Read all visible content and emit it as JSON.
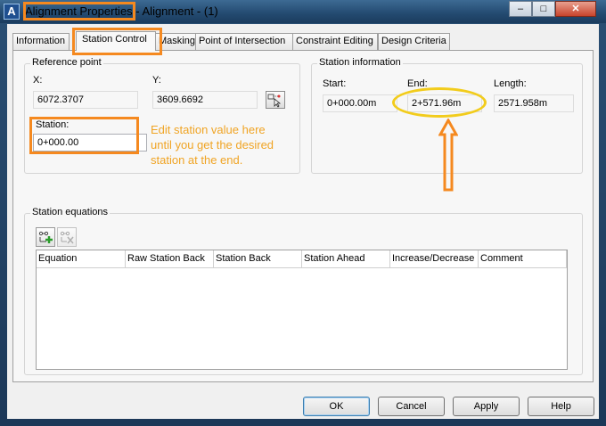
{
  "window": {
    "title": "Alignment Properties - Alignment - (1)",
    "icon": "autocad-icon",
    "controls": {
      "minimize": "–",
      "maximize": "□",
      "close": "✕"
    }
  },
  "tabs": [
    {
      "label": "Information",
      "active": false
    },
    {
      "label": "Station Control",
      "active": true
    },
    {
      "label": "Masking",
      "active": false
    },
    {
      "label": "Point of Intersection",
      "active": false
    },
    {
      "label": "Constraint Editing",
      "active": false
    },
    {
      "label": "Design Criteria",
      "active": false
    }
  ],
  "reference_point": {
    "title": "Reference point",
    "x_label": "X:",
    "x_value": "6072.3707",
    "y_label": "Y:",
    "y_value": "3609.6692",
    "station_label": "Station:",
    "station_value": "0+000.00"
  },
  "annotation": {
    "line1": "Edit station value here",
    "line2": "until you get the desired",
    "line3": "station at the end.",
    "color": "#f0a424"
  },
  "station_information": {
    "title": "Station information",
    "start_label": "Start:",
    "start_value": "0+000.00m",
    "end_label": "End:",
    "end_value": "2+571.96m",
    "length_label": "Length:",
    "length_value": "2571.958m"
  },
  "station_equations": {
    "title": "Station equations",
    "columns": [
      "Equation",
      "Raw Station Back",
      "Station Back",
      "Station Ahead",
      "Increase/Decrease",
      "Comment"
    ],
    "rows": []
  },
  "buttons": {
    "ok": "OK",
    "cancel": "Cancel",
    "apply": "Apply",
    "help": "Help"
  },
  "accent_colors": {
    "highlight_box": "#f5891f",
    "highlight_ellipse": "#f2cc1c"
  }
}
